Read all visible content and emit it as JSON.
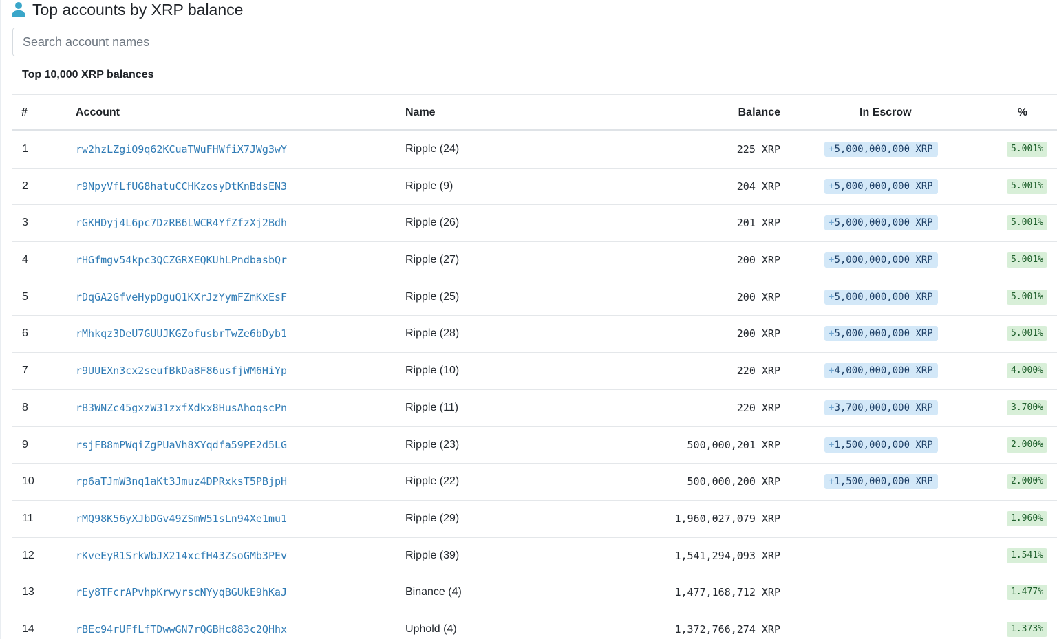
{
  "header": {
    "title": "Top accounts by XRP balance",
    "icon": "user-icon",
    "icon_color": "#3aa6c9"
  },
  "search": {
    "placeholder": "Search account names",
    "value": ""
  },
  "table": {
    "caption": "Top 10,000 XRP balances",
    "columns": [
      "#",
      "Account",
      "Name",
      "Balance",
      "In Escrow",
      "%"
    ],
    "rows": [
      {
        "rank": "1",
        "account": "rw2hzLZgiQ9q62KCuaTWuFHWfiX7JWg3wY",
        "name": "Ripple (24)",
        "balance": "225 XRP",
        "escrow": "5,000,000,000 XRP",
        "pct": "5.001%"
      },
      {
        "rank": "2",
        "account": "r9NpyVfLfUG8hatuCCHKzosyDtKnBdsEN3",
        "name": "Ripple (9)",
        "balance": "204 XRP",
        "escrow": "5,000,000,000 XRP",
        "pct": "5.001%"
      },
      {
        "rank": "3",
        "account": "rGKHDyj4L6pc7DzRB6LWCR4YfZfzXj2Bdh",
        "name": "Ripple (26)",
        "balance": "201 XRP",
        "escrow": "5,000,000,000 XRP",
        "pct": "5.001%"
      },
      {
        "rank": "4",
        "account": "rHGfmgv54kpc3QCZGRXEQKUhLPndbasbQr",
        "name": "Ripple (27)",
        "balance": "200 XRP",
        "escrow": "5,000,000,000 XRP",
        "pct": "5.001%"
      },
      {
        "rank": "5",
        "account": "rDqGA2GfveHypDguQ1KXrJzYymFZmKxEsF",
        "name": "Ripple (25)",
        "balance": "200 XRP",
        "escrow": "5,000,000,000 XRP",
        "pct": "5.001%"
      },
      {
        "rank": "6",
        "account": "rMhkqz3DeU7GUUJKGZofusbrTwZe6bDyb1",
        "name": "Ripple (28)",
        "balance": "200 XRP",
        "escrow": "5,000,000,000 XRP",
        "pct": "5.001%"
      },
      {
        "rank": "7",
        "account": "r9UUEXn3cx2seufBkDa8F86usfjWM6HiYp",
        "name": "Ripple (10)",
        "balance": "220 XRP",
        "escrow": "4,000,000,000 XRP",
        "pct": "4.000%"
      },
      {
        "rank": "8",
        "account": "rB3WNZc45gxzW31zxfXdkx8HusAhoqscPn",
        "name": "Ripple (11)",
        "balance": "220 XRP",
        "escrow": "3,700,000,000 XRP",
        "pct": "3.700%"
      },
      {
        "rank": "9",
        "account": "rsjFB8mPWqiZgPUaVh8XYqdfa59PE2d5LG",
        "name": "Ripple (23)",
        "balance": "500,000,201 XRP",
        "escrow": "1,500,000,000 XRP",
        "pct": "2.000%"
      },
      {
        "rank": "10",
        "account": "rp6aTJmW3nq1aKt3Jmuz4DPRxksT5PBjpH",
        "name": "Ripple (22)",
        "balance": "500,000,200 XRP",
        "escrow": "1,500,000,000 XRP",
        "pct": "2.000%"
      },
      {
        "rank": "11",
        "account": "rMQ98K56yXJbDGv49ZSmW51sLn94Xe1mu1",
        "name": "Ripple (29)",
        "balance": "1,960,027,079 XRP",
        "escrow": "",
        "pct": "1.960%"
      },
      {
        "rank": "12",
        "account": "rKveEyR1SrkWbJX214xcfH43ZsoGMb3PEv",
        "name": "Ripple (39)",
        "balance": "1,541,294,093 XRP",
        "escrow": "",
        "pct": "1.541%"
      },
      {
        "rank": "13",
        "account": "rEy8TFcrAPvhpKrwyrscNYyqBGUkE9hKaJ",
        "name": "Binance (4)",
        "balance": "1,477,168,712 XRP",
        "escrow": "",
        "pct": "1.477%"
      },
      {
        "rank": "14",
        "account": "rBEc94rUFfLfTDwwGN7rQGBHc883c2QHhx",
        "name": "Uphold (4)",
        "balance": "1,372,766,274 XRP",
        "escrow": "",
        "pct": "1.373%"
      }
    ]
  },
  "colors": {
    "link": "#2f7bb5",
    "escrow_bg": "#d3e8f8",
    "pct_bg": "#d8efd8"
  }
}
